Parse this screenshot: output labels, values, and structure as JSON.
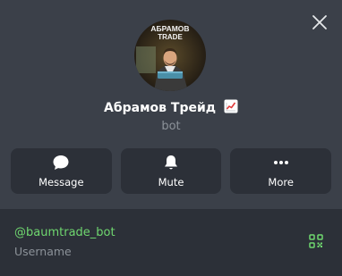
{
  "profile": {
    "name": "Абрамов Трейд",
    "name_emoji": "chart-increasing-emoji",
    "subtitle": "bot",
    "avatar": {
      "text_line1": "АБРАМОВ",
      "text_line2": "TRADE"
    }
  },
  "actions": [
    {
      "label": "Message",
      "icon": "message-bubble-icon"
    },
    {
      "label": "Mute",
      "icon": "bell-icon"
    },
    {
      "label": "More",
      "icon": "more-dots-icon"
    }
  ],
  "info": {
    "username": "@baumtrade_bot",
    "username_label": "Username",
    "qr_icon": "qr-code-icon"
  },
  "colors": {
    "panel_bg": "#3b4049",
    "button_bg": "#2c3038",
    "accent_green": "#6fd76f",
    "muted_text": "#8c9299"
  }
}
